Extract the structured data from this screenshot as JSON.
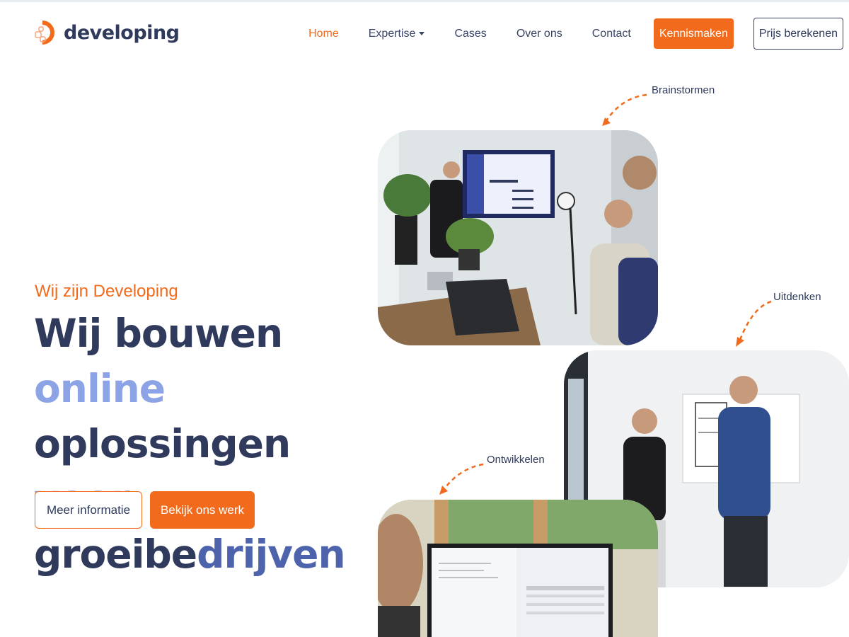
{
  "brand": {
    "name": "developing"
  },
  "nav": {
    "items": [
      {
        "label": "Home",
        "active": true
      },
      {
        "label": "Expertise",
        "dropdown": true
      },
      {
        "label": "Cases"
      },
      {
        "label": "Over ons"
      },
      {
        "label": "Contact"
      }
    ],
    "cta_primary": "Kennismaken",
    "cta_secondary": "Prijs berekenen"
  },
  "hero": {
    "eyebrow": "Wij zijn Developing",
    "headline_parts": {
      "p1": "Wij bouwen",
      "p2": "online",
      "p3": "oplossingen",
      "p4": "voor",
      "p5": "groeibe",
      "p6": "drijven"
    },
    "btn_secondary": "Meer informatie",
    "btn_primary": "Bekijk ons werk"
  },
  "steps": {
    "brainstorm": "Brainstormen",
    "uitdenken": "Uitdenken",
    "ontwikkelen": "Ontwikkelen"
  },
  "colors": {
    "accent": "#f26b1d",
    "navy": "#2f3a5c",
    "blue_mid": "#4d64ad",
    "blue_light": "#8ca4e6"
  }
}
